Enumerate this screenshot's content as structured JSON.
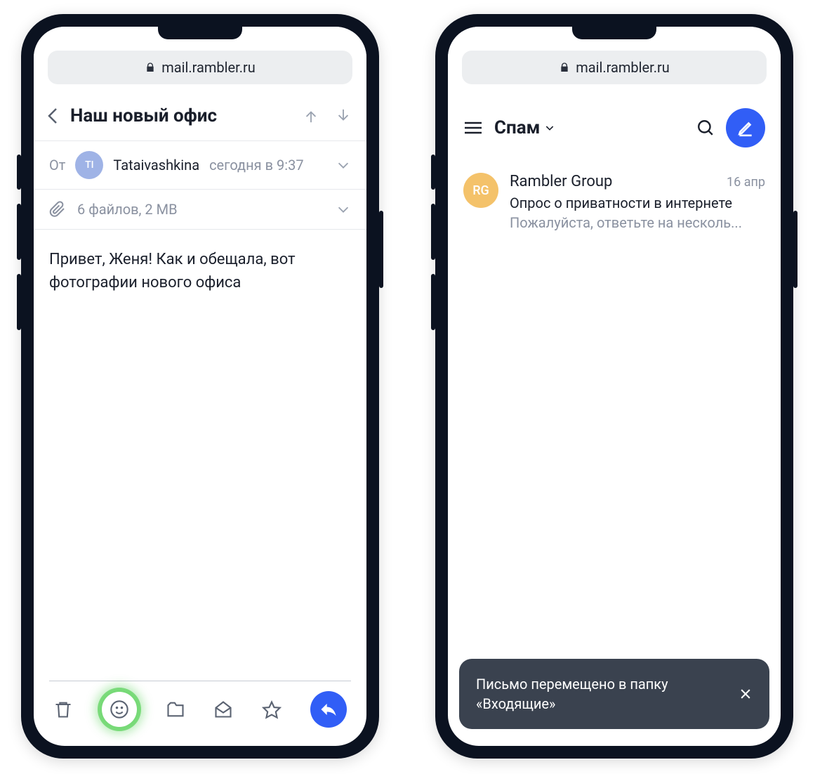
{
  "address_bar": {
    "url": "mail.rambler.ru"
  },
  "phone1": {
    "header": {
      "subject": "Наш новый офис"
    },
    "from": {
      "label": "От",
      "avatar_initials": "TI",
      "name": "Tataivashkina",
      "time": "сегодня в 9:37"
    },
    "attachments": {
      "summary": "6 файлов, 2 MB"
    },
    "body": "Привет, Женя! Как и обещала, вот фотографии нового офиса"
  },
  "phone2": {
    "folder_title": "Спам",
    "mail": {
      "avatar_initials": "RG",
      "sender": "Rambler Group",
      "date": "16 апр",
      "subject": "Опрос о приватности в интернете",
      "preview": "Пожалуйста, ответьте на несколь..."
    },
    "toast": {
      "text": "Письмо перемещено в папку «Входящие»"
    }
  }
}
